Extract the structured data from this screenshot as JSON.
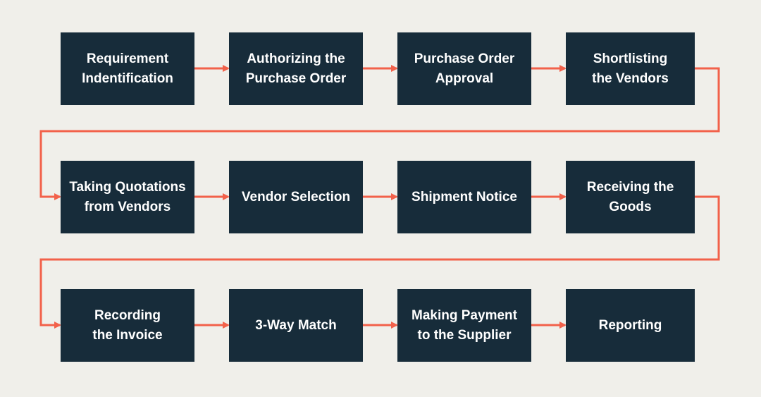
{
  "diagram": {
    "type": "flowchart",
    "colors": {
      "background": "#f0efea",
      "box": "#172c3a",
      "text": "#ffffff",
      "arrow": "#f2614a"
    },
    "steps": [
      {
        "label": "Requirement\nIndentification"
      },
      {
        "label": "Authorizing the\nPurchase Order"
      },
      {
        "label": "Purchase Order\nApproval"
      },
      {
        "label": "Shortlisting\nthe Vendors"
      },
      {
        "label": "Taking Quotations\nfrom Vendors"
      },
      {
        "label": "Vendor Selection"
      },
      {
        "label": "Shipment Notice"
      },
      {
        "label": "Receiving the\nGoods"
      },
      {
        "label": "Recording\nthe Invoice"
      },
      {
        "label": "3-Way Match"
      },
      {
        "label": "Making Payment\nto the Supplier"
      },
      {
        "label": "Reporting"
      }
    ]
  }
}
